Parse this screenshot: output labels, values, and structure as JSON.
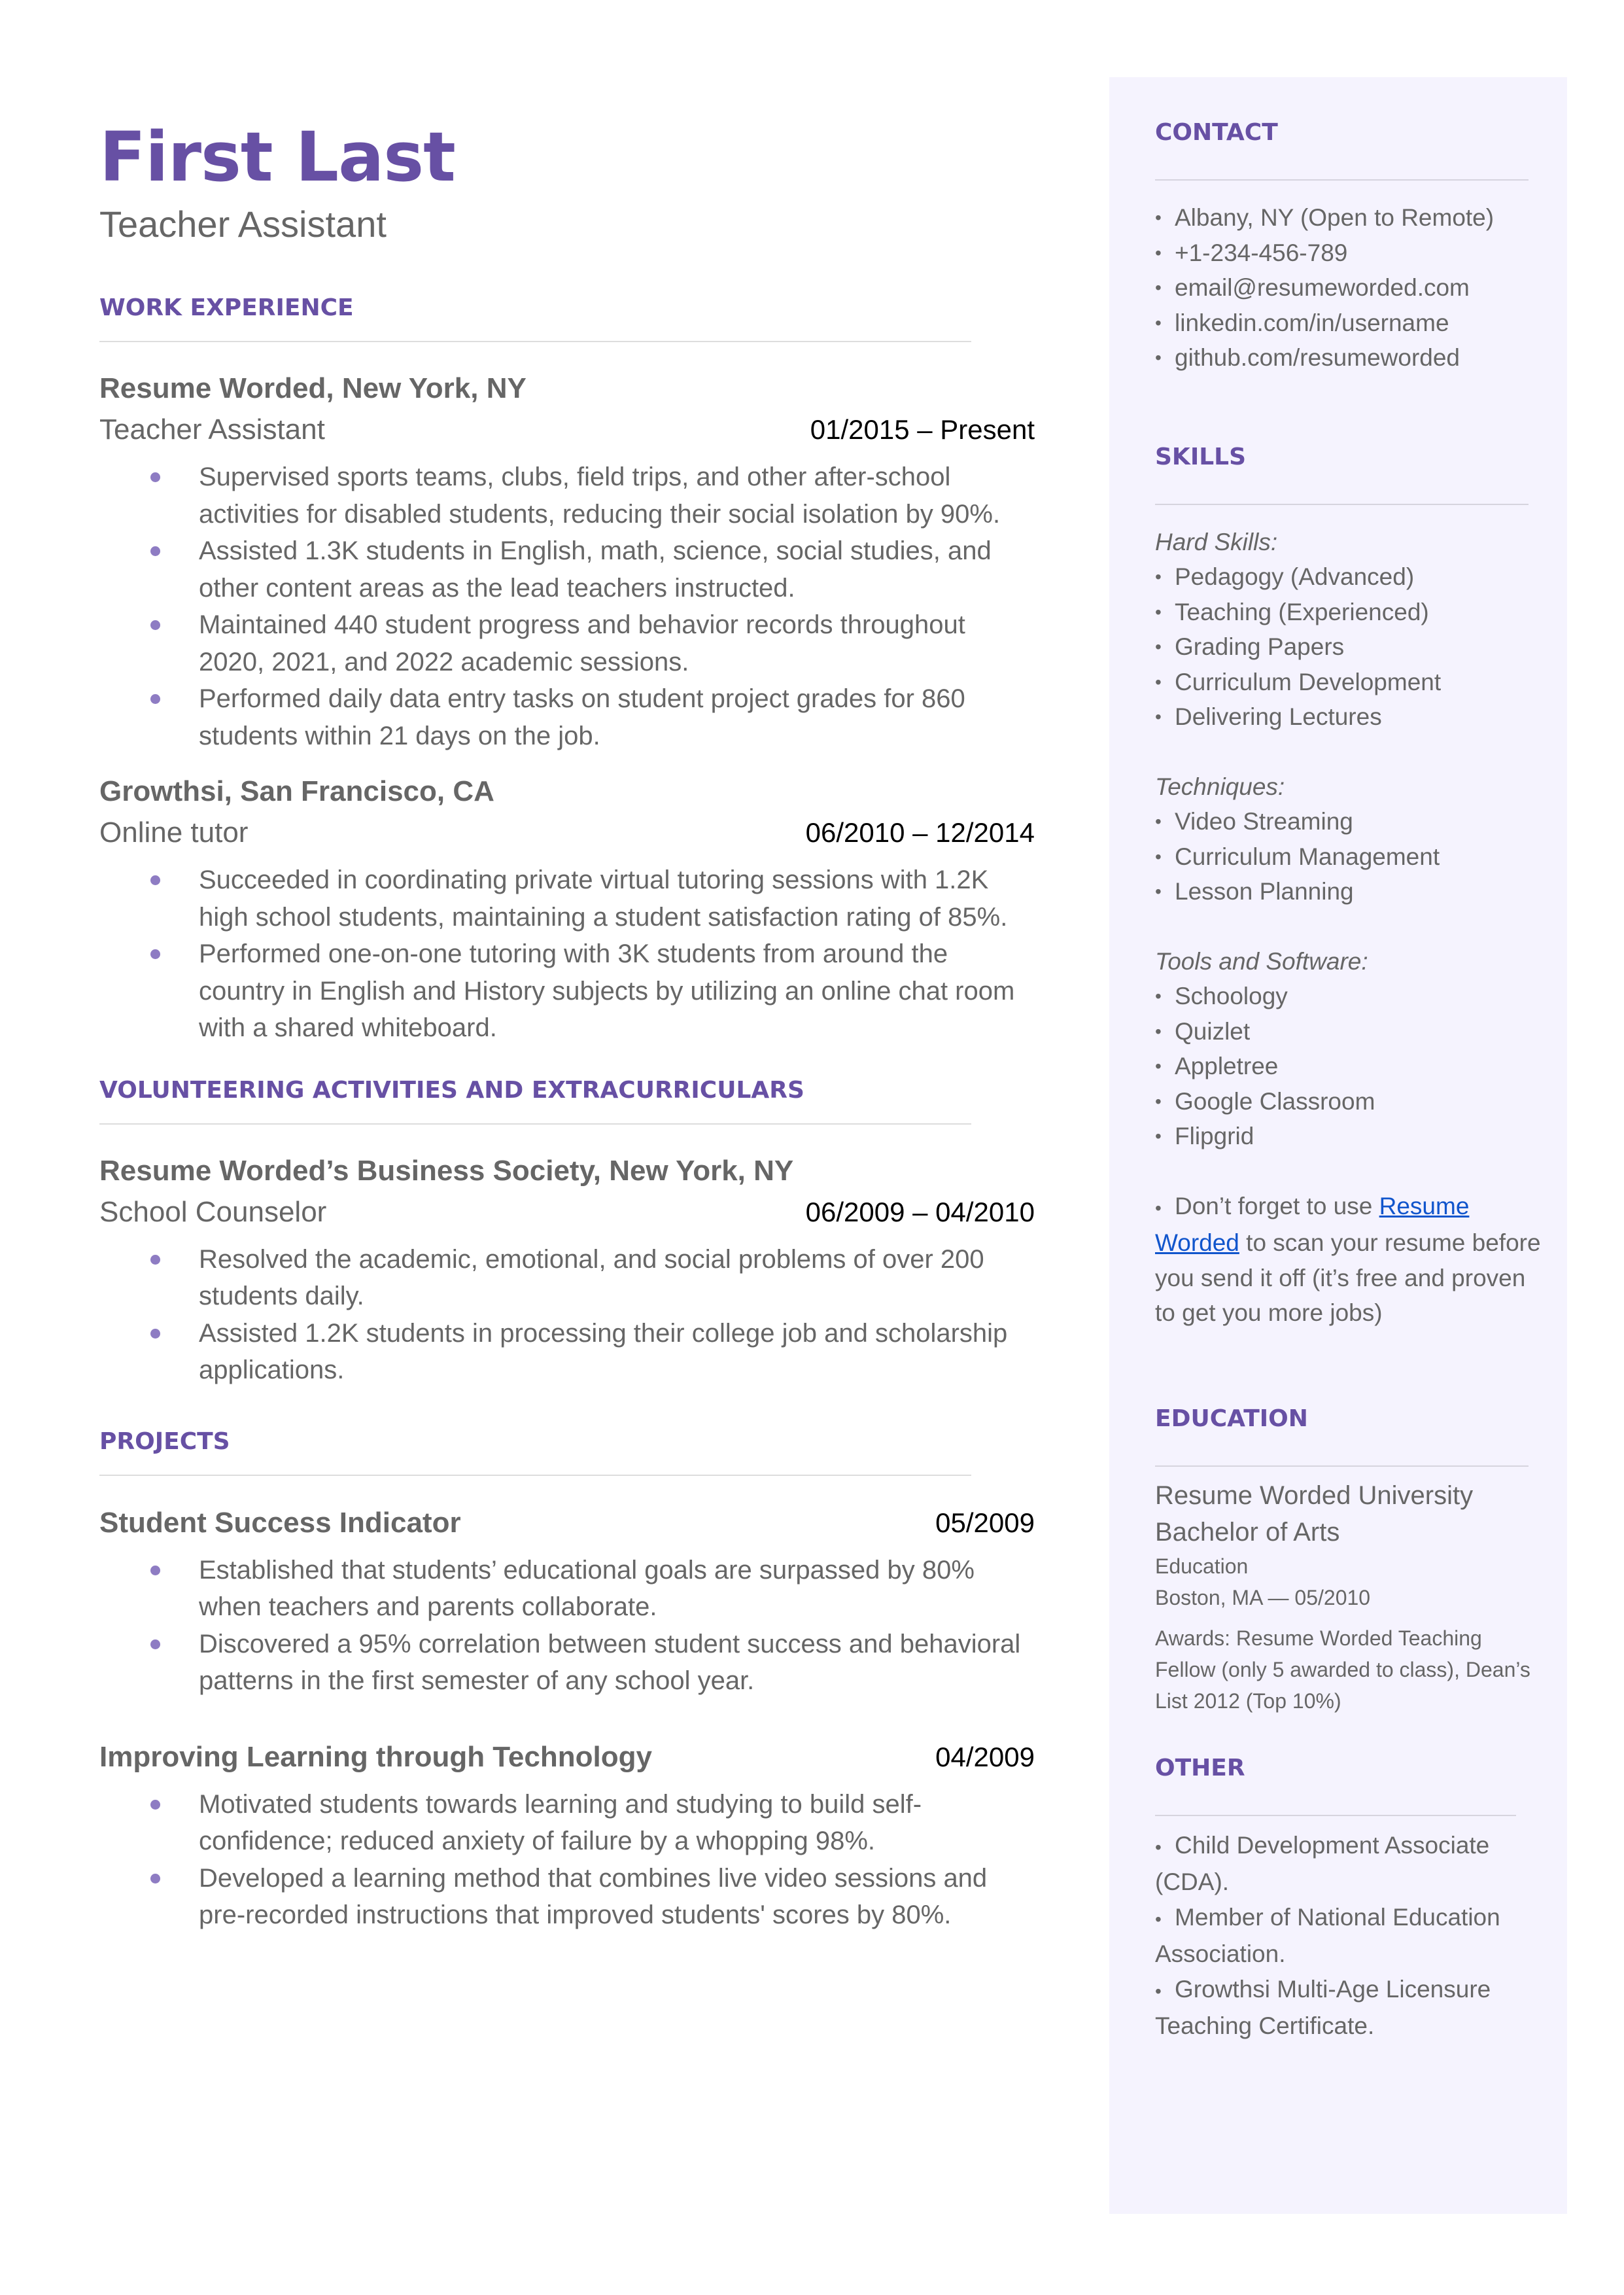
{
  "header": {
    "name": "First Last",
    "title": "Teacher Assistant"
  },
  "colors": {
    "accent": "#6750A4",
    "bullet": "#8E7CC3",
    "sidebar_bg": "#F5F3FE",
    "link": "#1155cc"
  },
  "work": {
    "heading": "WORK EXPERIENCE",
    "entries": [
      {
        "company": "Resume Worded, New York, NY",
        "role": "Teacher Assistant",
        "dates": "01/2015 – Present",
        "bullets": [
          "Supervised sports teams, clubs, field trips, and other after-school activities for disabled students, reducing their social isolation by 90%.",
          "Assisted 1.3K students in English, math, science, social studies, and other content areas as the lead teachers instructed.",
          "Maintained 440 student progress and behavior records throughout 2020, 2021, and 2022 academic sessions.",
          "Performed daily data entry tasks on student project grades for 860 students within 21 days on the job."
        ]
      },
      {
        "company": "Growthsi, San Francisco, CA",
        "role": "Online tutor",
        "dates": "06/2010 – 12/2014",
        "bullets": [
          "Succeeded in coordinating private virtual tutoring sessions with 1.2K high school students, maintaining a student satisfaction rating of 85%.",
          "Performed one-on-one tutoring with 3K students from around the country in English and History subjects by utilizing an online chat room with a shared whiteboard."
        ]
      }
    ]
  },
  "volunteering": {
    "heading": "VOLUNTEERING ACTIVITIES AND EXTRACURRICULARS",
    "entries": [
      {
        "company": "Resume Worded’s Business Society, New York, NY",
        "role": "School Counselor",
        "dates": "06/2009 – 04/2010",
        "bullets": [
          "Resolved the academic, emotional, and social problems of over 200 students daily.",
          "Assisted 1.2K students in processing their college job and scholarship applications."
        ]
      }
    ]
  },
  "projects": {
    "heading": "PROJECTS",
    "entries": [
      {
        "name": "Student Success Indicator",
        "date": "05/2009",
        "bullets": [
          "Established that students’ educational goals are surpassed by 80% when teachers and parents collaborate.",
          "Discovered a 95% correlation between student success and behavioral patterns in the first semester of any school year."
        ]
      },
      {
        "name": "Improving Learning through Technology",
        "date": "04/2009",
        "bullets": [
          "Motivated students towards learning and studying to build self-confidence; reduced anxiety of failure by a whopping 98%.",
          "Developed a learning method that combines live video sessions and pre-recorded instructions that improved students' scores by 80%."
        ]
      }
    ]
  },
  "sidebar": {
    "contact": {
      "heading": "CONTACT",
      "items": [
        "Albany, NY (Open to Remote)",
        "+1-234-456-789",
        "email@resumeworded.com",
        "linkedin.com/in/username",
        "github.com/resumeworded"
      ]
    },
    "skills": {
      "heading": "SKILLS",
      "groups": [
        {
          "label": "Hard Skills:",
          "items": [
            "Pedagogy (Advanced)",
            "Teaching (Experienced)",
            "Grading Papers",
            "Curriculum Development",
            "Delivering Lectures"
          ]
        },
        {
          "label": "Techniques:",
          "items": [
            "Video Streaming",
            "Curriculum Management",
            "Lesson Planning"
          ]
        },
        {
          "label": "Tools and Software:",
          "items": [
            "Schoology",
            "Quizlet",
            "Appletree",
            "Google Classroom",
            "Flipgrid"
          ]
        }
      ],
      "note_before": "Don’t forget to use ",
      "note_link": "Resume Worded",
      "note_after": " to scan your resume before you send it off (it’s free and proven to get you more jobs)"
    },
    "education": {
      "heading": "EDUCATION",
      "school": "Resume Worded University",
      "degree": "Bachelor of Arts",
      "field": "Education",
      "location_date": "Boston, MA — 05/2010",
      "awards": "Awards: Resume Worded Teaching Fellow (only 5 awarded to class), Dean’s List 2012 (Top 10%)"
    },
    "other": {
      "heading": "OTHER",
      "items": [
        "Child Development Associate (CDA).",
        "Member of National Education Association.",
        "Growthsi Multi-Age Licensure Teaching Certificate."
      ]
    }
  }
}
